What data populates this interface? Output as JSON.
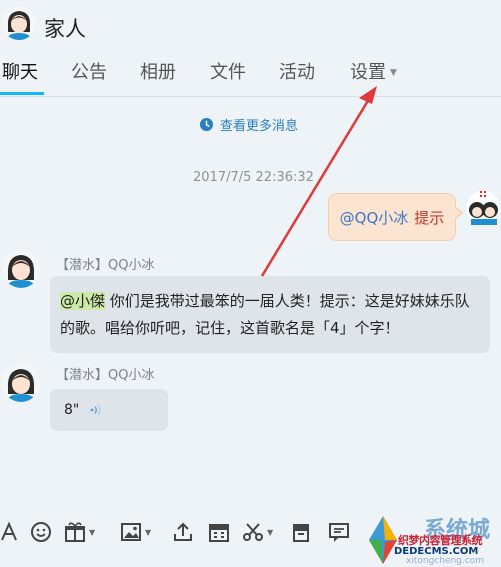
{
  "header": {
    "group_name": "家人"
  },
  "tabs": [
    {
      "label": "聊天"
    },
    {
      "label": "公告"
    },
    {
      "label": "相册"
    },
    {
      "label": "文件"
    },
    {
      "label": "活动"
    },
    {
      "label": "设置"
    }
  ],
  "chat": {
    "more_messages": "查看更多消息",
    "timestamp": "2017/7/5 22:36:32",
    "self_message": {
      "mention": "@QQ小冰",
      "text": "提示"
    },
    "messages": [
      {
        "sender": "【潜水】QQ小冰",
        "mention": "@小傑",
        "text": " 你们是我带过最笨的一届人类！提示：这是好妹妹乐队的歌。唱给你听吧，记住，这首歌名是「4」个字！"
      },
      {
        "sender": "【潜水】QQ小冰",
        "text": "8\""
      }
    ]
  },
  "toolbar": {
    "icons": [
      "font-icon",
      "emoji-icon",
      "gift-icon",
      "image-icon",
      "upload-icon",
      "calendar-icon",
      "scissors-icon",
      "archive-icon",
      "comment-icon"
    ]
  },
  "watermark": {
    "brand_big": "系统城",
    "brand_cn": "织梦内容管理系统",
    "url": "DEDECMS.COM",
    "small": "xitongcheng.com"
  },
  "colors": {
    "accent": "#12b7f5",
    "link": "#2a7ec3",
    "self_bubble": "#fbe5d1",
    "other_bubble": "#dfe4ea",
    "annotation_arrow": "#e0393c"
  }
}
